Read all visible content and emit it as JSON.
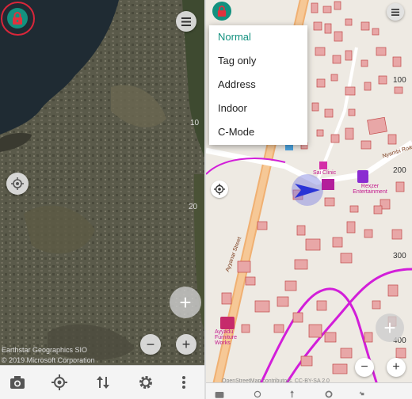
{
  "left_pane": {
    "attribution": "© 2019 Microsoft Corporation",
    "attribution_partial": "Earthstar Geographics SIO",
    "scale_labels": [
      "10",
      "20"
    ]
  },
  "right_pane": {
    "mode_menu": {
      "items": [
        {
          "label": "Normal",
          "selected": true
        },
        {
          "label": "Tag only",
          "selected": false
        },
        {
          "label": "Address",
          "selected": false
        },
        {
          "label": "Indoor",
          "selected": false
        },
        {
          "label": "C-Mode",
          "selected": false
        }
      ]
    },
    "scale_labels": [
      "100",
      "200",
      "300",
      "400"
    ],
    "road_labels": [
      "Ayyanar Street",
      "Nyambi Road"
    ],
    "poi_labels": {
      "clinic": "Sai Clinic",
      "entertainment": "Rexzer Entertainment",
      "furniture": "Ayyadu Furniture Works"
    },
    "attribution": "OpenStreetMap contributors, CC-BY-SA 2.0"
  },
  "accent_color": "#13917f",
  "lock_color": "#e1323d",
  "highlight_ring_color": "#d9263a",
  "building_color": "#e8a7a7",
  "path_color": "#d21ed9",
  "road_color": "#f0b072",
  "toolbar_icons": [
    "camera-icon",
    "gps-icon",
    "sort-icon",
    "settings-icon",
    "more-icon"
  ]
}
